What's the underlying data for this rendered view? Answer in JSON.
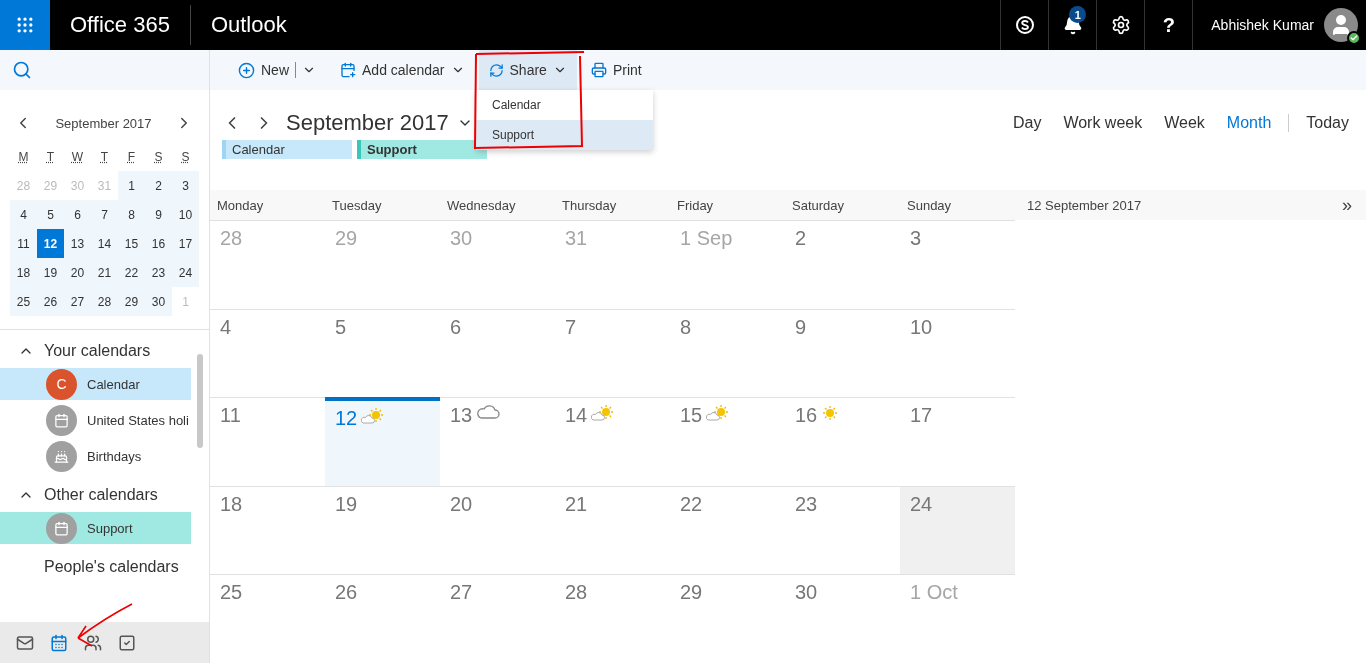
{
  "top_bar": {
    "brand": "Office 365",
    "app": "Outlook",
    "actions": [
      {
        "kind": "skype"
      },
      {
        "kind": "notifications",
        "badge": "1"
      },
      {
        "kind": "settings"
      },
      {
        "kind": "help",
        "label": "?"
      }
    ],
    "user": "Abhishek Kumar",
    "user_online": true
  },
  "toolbar": {
    "buttons": [
      {
        "kind": "new",
        "label": "New",
        "split": true,
        "open": false
      },
      {
        "kind": "add",
        "label": "Add calendar",
        "split": false,
        "open": false
      },
      {
        "kind": "share",
        "label": "Share",
        "split": false,
        "open": true
      },
      {
        "kind": "print",
        "label": "Print",
        "split": false,
        "open": false
      }
    ],
    "share_menu": [
      {
        "label": "Calendar",
        "selected": false
      },
      {
        "label": "Support",
        "selected": true
      }
    ]
  },
  "mini_calendar": {
    "title": "September 2017",
    "weekdays": [
      "M",
      "T",
      "W",
      "T",
      "F",
      "S",
      "S"
    ],
    "weeks": [
      [
        {
          "d": "28",
          "in_month": false,
          "selected": false
        },
        {
          "d": "29",
          "in_month": false,
          "selected": false
        },
        {
          "d": "30",
          "in_month": false,
          "selected": false
        },
        {
          "d": "31",
          "in_month": false,
          "selected": false
        },
        {
          "d": "1",
          "in_month": true,
          "selected": false
        },
        {
          "d": "2",
          "in_month": true,
          "selected": false
        },
        {
          "d": "3",
          "in_month": true,
          "selected": false
        }
      ],
      [
        {
          "d": "4",
          "in_month": true,
          "selected": false
        },
        {
          "d": "5",
          "in_month": true,
          "selected": false
        },
        {
          "d": "6",
          "in_month": true,
          "selected": false
        },
        {
          "d": "7",
          "in_month": true,
          "selected": false
        },
        {
          "d": "8",
          "in_month": true,
          "selected": false
        },
        {
          "d": "9",
          "in_month": true,
          "selected": false
        },
        {
          "d": "10",
          "in_month": true,
          "selected": false
        }
      ],
      [
        {
          "d": "11",
          "in_month": true,
          "selected": false
        },
        {
          "d": "12",
          "in_month": true,
          "selected": true
        },
        {
          "d": "13",
          "in_month": true,
          "selected": false
        },
        {
          "d": "14",
          "in_month": true,
          "selected": false
        },
        {
          "d": "15",
          "in_month": true,
          "selected": false
        },
        {
          "d": "16",
          "in_month": true,
          "selected": false
        },
        {
          "d": "17",
          "in_month": true,
          "selected": false
        }
      ],
      [
        {
          "d": "18",
          "in_month": true,
          "selected": false
        },
        {
          "d": "19",
          "in_month": true,
          "selected": false
        },
        {
          "d": "20",
          "in_month": true,
          "selected": false
        },
        {
          "d": "21",
          "in_month": true,
          "selected": false
        },
        {
          "d": "22",
          "in_month": true,
          "selected": false
        },
        {
          "d": "23",
          "in_month": true,
          "selected": false
        },
        {
          "d": "24",
          "in_month": true,
          "selected": false
        }
      ],
      [
        {
          "d": "25",
          "in_month": true,
          "selected": false
        },
        {
          "d": "26",
          "in_month": true,
          "selected": false
        },
        {
          "d": "27",
          "in_month": true,
          "selected": false
        },
        {
          "d": "28",
          "in_month": true,
          "selected": false
        },
        {
          "d": "29",
          "in_month": true,
          "selected": false
        },
        {
          "d": "30",
          "in_month": true,
          "selected": false
        },
        {
          "d": "1",
          "in_month": false,
          "selected": false
        }
      ]
    ]
  },
  "calendar_groups": [
    {
      "title": "Your calendars",
      "expanded": true,
      "items": [
        {
          "name": "Calendar",
          "kind": "letter",
          "letter": "C",
          "color": "#d9532c",
          "selected": true
        },
        {
          "name": "United States holi",
          "kind": "calendar",
          "color": "#a0a0a0",
          "selected": false
        },
        {
          "name": "Birthdays",
          "kind": "cake",
          "color": "#a0a0a0",
          "selected": false
        }
      ]
    },
    {
      "title": "Other calendars",
      "expanded": true,
      "items": [
        {
          "name": "Support",
          "kind": "calendar",
          "color": "#a0a0a0",
          "selected": true
        }
      ]
    },
    {
      "title": "People's calendars",
      "expanded": false
    }
  ],
  "bottom_nav": [
    {
      "kind": "mail",
      "selected": false
    },
    {
      "kind": "calendar",
      "selected": true
    },
    {
      "kind": "people",
      "selected": false
    },
    {
      "kind": "tasks",
      "selected": false
    }
  ],
  "header": {
    "title": "September 2017",
    "views": [
      {
        "label": "Day",
        "selected": false
      },
      {
        "label": "Work week",
        "selected": false
      },
      {
        "label": "Week",
        "selected": false
      },
      {
        "label": "Month",
        "selected": true
      }
    ],
    "today": "Today",
    "chips": [
      {
        "label": "Calendar",
        "color": "#c7e8fa",
        "selected": false
      },
      {
        "label": "Support",
        "color": "#a0e9e3",
        "selected": true
      }
    ]
  },
  "month_grid": {
    "weekdays": [
      "Monday",
      "Tuesday",
      "Wednesday",
      "Thursday",
      "Friday",
      "Saturday",
      "Sunday"
    ],
    "weeks": [
      [
        {
          "d": "28",
          "muted": true
        },
        {
          "d": "29",
          "muted": true
        },
        {
          "d": "30",
          "muted": true
        },
        {
          "d": "31",
          "muted": true
        },
        {
          "d": "1 Sep",
          "muted": true
        },
        {
          "d": "2",
          "muted": false
        },
        {
          "d": "3",
          "muted": false
        }
      ],
      [
        {
          "d": "4",
          "muted": false
        },
        {
          "d": "5",
          "muted": false
        },
        {
          "d": "6",
          "muted": false
        },
        {
          "d": "7",
          "muted": false
        },
        {
          "d": "8",
          "muted": false
        },
        {
          "d": "9",
          "muted": false
        },
        {
          "d": "10",
          "muted": false
        }
      ],
      [
        {
          "d": "11",
          "muted": false
        },
        {
          "d": "12",
          "muted": false,
          "today": true,
          "weather": {
            "kind": "partly_sunny"
          }
        },
        {
          "d": "13",
          "muted": false,
          "weather": {
            "kind": "cloudy"
          }
        },
        {
          "d": "14",
          "muted": false,
          "weather": {
            "kind": "partly_sunny"
          }
        },
        {
          "d": "15",
          "muted": false,
          "weather": {
            "kind": "partly_sunny"
          }
        },
        {
          "d": "16",
          "muted": false,
          "weather": {
            "kind": "sunny"
          }
        },
        {
          "d": "17",
          "muted": false
        }
      ],
      [
        {
          "d": "18",
          "muted": false
        },
        {
          "d": "19",
          "muted": false
        },
        {
          "d": "20",
          "muted": false
        },
        {
          "d": "21",
          "muted": false
        },
        {
          "d": "22",
          "muted": false
        },
        {
          "d": "23",
          "muted": false
        },
        {
          "d": "24",
          "muted": false,
          "hovered": true
        }
      ],
      [
        {
          "d": "25",
          "muted": false
        },
        {
          "d": "26",
          "muted": false
        },
        {
          "d": "27",
          "muted": false
        },
        {
          "d": "28",
          "muted": false
        },
        {
          "d": "29",
          "muted": false
        },
        {
          "d": "30",
          "muted": false
        },
        {
          "d": "1 Oct",
          "muted": true
        }
      ]
    ]
  },
  "day_pane": {
    "title": "12 September 2017",
    "expand": "»"
  }
}
